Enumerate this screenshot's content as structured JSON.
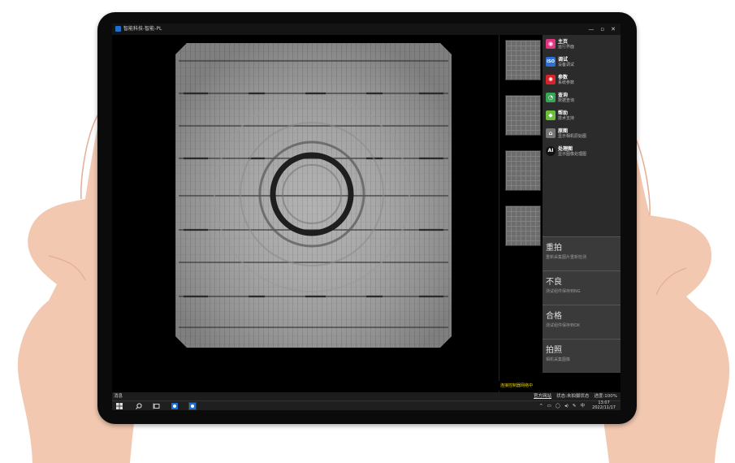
{
  "window": {
    "title": "智能科技-智能-PL",
    "controls": [
      "—",
      "▫",
      "✕"
    ]
  },
  "menu": {
    "items": [
      {
        "label": "主页",
        "sub": "运行界面",
        "icon": "camera-icon",
        "color": "#e2357f",
        "glyph": "◉"
      },
      {
        "label": "调试",
        "sub": "设备调试",
        "icon": "iso-icon",
        "color": "#2f6fd1",
        "glyph": "ISO"
      },
      {
        "label": "参数",
        "sub": "系统参数",
        "icon": "parameter-icon",
        "color": "#d8232a",
        "glyph": "✺"
      },
      {
        "label": "查询",
        "sub": "数据查询",
        "icon": "query-icon",
        "color": "#3aa655",
        "glyph": "◔"
      },
      {
        "label": "帮助",
        "sub": "技术支持",
        "icon": "help-icon",
        "color": "#6cbf3a",
        "glyph": "◆"
      },
      {
        "label": "原图",
        "sub": "显示相机原始图",
        "icon": "home-icon",
        "color": "#777777",
        "glyph": "⌂"
      },
      {
        "label": "处理图",
        "sub": "显示图像处理图",
        "icon": "ai-icon",
        "color": "#1a1a1a",
        "glyph": "AI"
      }
    ]
  },
  "actions": [
    {
      "label": "重拍",
      "sub": "重新采集图片重新检测"
    },
    {
      "label": "不良",
      "sub": "测试组件保存到NG"
    },
    {
      "label": "合格",
      "sub": "测试组件保存到OK"
    },
    {
      "label": "拍照",
      "sub": "相机采集图像"
    }
  ],
  "status": {
    "message": "消息",
    "yellow": "连接控制器网络中",
    "website": "官方网站",
    "state": "状态:未拍摄状态",
    "progress": "进度:100%"
  },
  "taskbar": {
    "time": "13:07",
    "date": "2022/11/17",
    "lang": "中"
  }
}
